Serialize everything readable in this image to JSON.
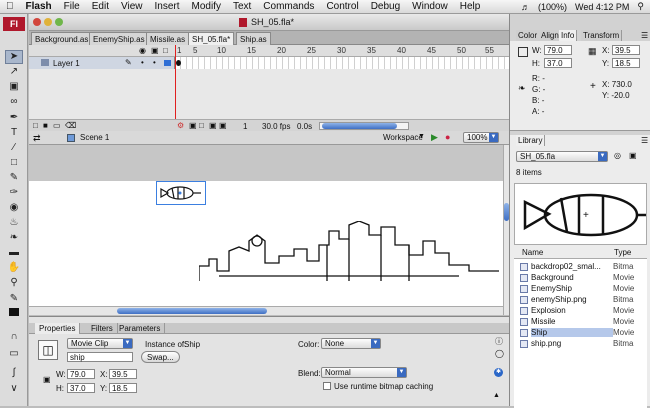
{
  "menubar": {
    "app": "Flash",
    "items": [
      "File",
      "Edit",
      "View",
      "Insert",
      "Modify",
      "Text",
      "Commands",
      "Control",
      "Debug",
      "Window",
      "Help"
    ],
    "battery": "(100%)",
    "clock": "Wed 4:12 PM"
  },
  "window": {
    "title": "SH_05.fla*"
  },
  "toolbox": {
    "badge": "Fl"
  },
  "doc_tabs": [
    "Background.as",
    "EnemyShip.as",
    "Missile.as",
    "SH_05.fla*",
    "Ship.as"
  ],
  "timeline": {
    "frame_labels": [
      "1",
      "5",
      "10",
      "15",
      "20",
      "25",
      "30",
      "35",
      "40",
      "45",
      "50",
      "55",
      "60",
      "65",
      "70"
    ],
    "layer": "Layer 1",
    "current_frame": "1",
    "fps": "30.0 fps",
    "time": "0.0s"
  },
  "editbar": {
    "scene": "Scene 1",
    "workspace": "Workspace",
    "zoom": "100%"
  },
  "properties": {
    "tabs": [
      "Properties",
      "Filters",
      "Parameters"
    ],
    "symbol_type": "Movie Clip",
    "instance_name": "ship",
    "instance_of_label": "Instance of:",
    "instance_of": "Ship",
    "swap": "Swap...",
    "color_label": "Color:",
    "color_value": "None",
    "blend_label": "Blend:",
    "blend_value": "Normal",
    "cache_label": "Use runtime bitmap caching",
    "w": "79.0",
    "h": "37.0",
    "x": "39.5",
    "y": "18.5",
    "w_label": "W:",
    "h_label": "H:",
    "x_label": "X:",
    "y_label": "Y:"
  },
  "info_panel": {
    "tabs": [
      "Color",
      "Align",
      "Info",
      "Transform"
    ],
    "w": "79.0",
    "h": "37.0",
    "x": "39.5",
    "y": "18.5",
    "r": "R: -",
    "g": "G: -",
    "b": "B: -",
    "a": "A: -",
    "cursor_x": "X: 730.0",
    "cursor_y": "Y: -20.0"
  },
  "library": {
    "tab": "Library",
    "file": "SH_05.fla",
    "count": "8 items",
    "col_name": "Name",
    "col_type": "Type",
    "items": [
      {
        "name": "backdrop02_smal...",
        "type": "Bitma"
      },
      {
        "name": "Background",
        "type": "Movie"
      },
      {
        "name": "EnemyShip",
        "type": "Movie"
      },
      {
        "name": "enemyShip.png",
        "type": "Bitma"
      },
      {
        "name": "Explosion",
        "type": "Movie"
      },
      {
        "name": "Missile",
        "type": "Movie"
      },
      {
        "name": "Ship",
        "type": "Movie"
      },
      {
        "name": "ship.png",
        "type": "Bitma"
      }
    ]
  }
}
